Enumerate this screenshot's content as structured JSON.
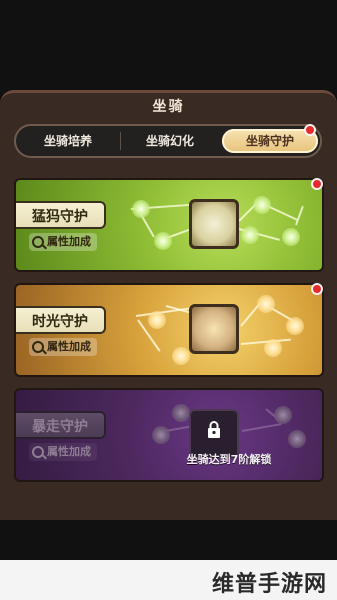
{
  "panel": {
    "title": "坐骑"
  },
  "tabs": [
    {
      "label": "坐骑培养"
    },
    {
      "label": "坐骑幻化"
    },
    {
      "label": "坐骑守护",
      "active": true
    }
  ],
  "cards": [
    {
      "title": "猛犸守护",
      "attr_label": "属性加成",
      "theme": "green",
      "has_notification": true
    },
    {
      "title": "时光守护",
      "attr_label": "属性加成",
      "theme": "gold",
      "has_notification": true
    },
    {
      "title": "暴走守护",
      "attr_label": "属性加成",
      "theme": "purple",
      "locked": true,
      "lock_text": "坐骑达到7阶解锁"
    }
  ],
  "watermark": {
    "text": "维普手游网"
  },
  "colors": {
    "notification": "#e52b2b",
    "active_tab": "#e7c27a"
  }
}
